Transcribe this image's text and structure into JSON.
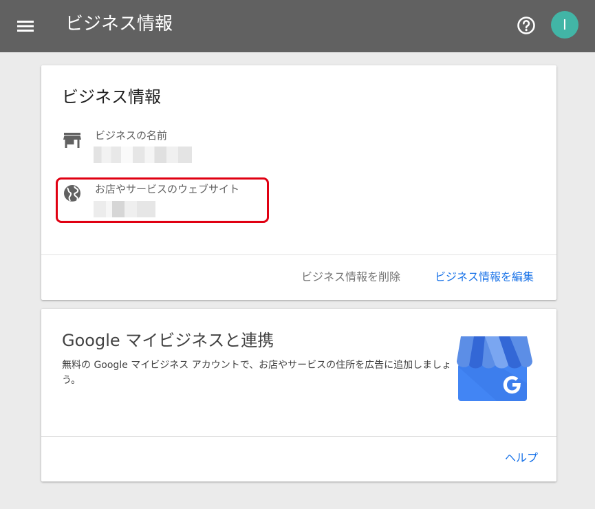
{
  "appbar": {
    "title": "ビジネス情報",
    "avatar_letter": "I",
    "menu_icon": "menu-icon",
    "help_icon": "help-circle-icon",
    "background": "#616161",
    "avatar_color": "#42b5a6"
  },
  "business_card": {
    "title": "ビジネス情報",
    "fields": [
      {
        "icon": "storefront-icon",
        "label": "ビジネスの名前"
      },
      {
        "icon": "globe-icon",
        "label": "お店やサービスのウェブサイト"
      }
    ],
    "actions": {
      "delete_label": "ビジネス情報を削除",
      "edit_label": "ビジネス情報を編集"
    },
    "highlight_color": "#e00012"
  },
  "gmb_card": {
    "title": "Google マイビジネスと連携",
    "description": "無料の Google マイビジネス アカウントで、お店やサービスの住所を広告に追加しましょう。",
    "logo_icon": "google-my-business-icon",
    "help_label": "ヘルプ",
    "accent_color": "#1a73e8"
  }
}
